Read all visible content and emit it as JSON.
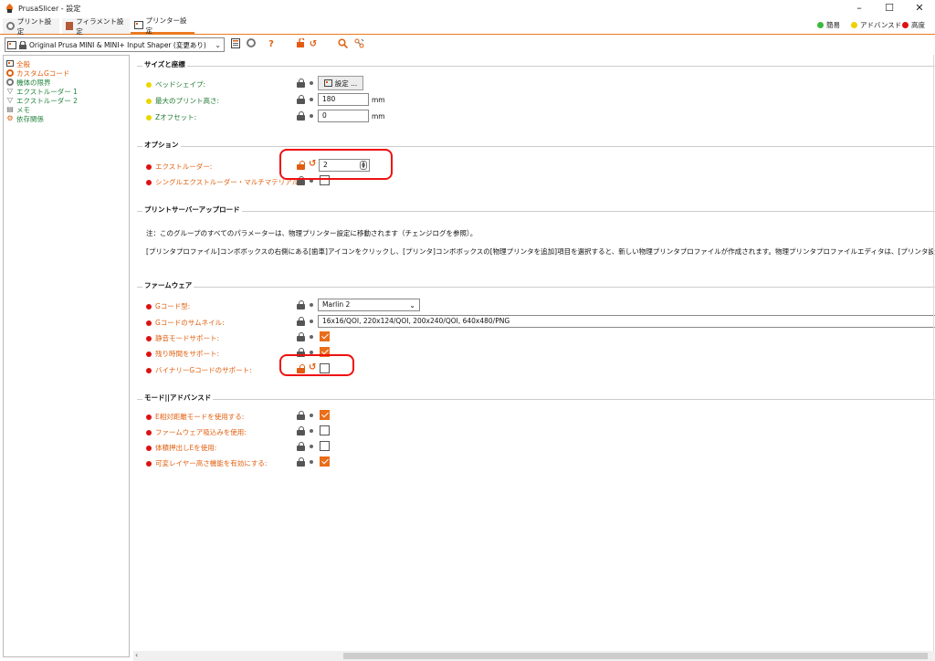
{
  "window": {
    "title": "PrusaSlicer - 設定",
    "minimize": "–",
    "maximize": "☐",
    "close": "✕"
  },
  "tabs": [
    {
      "label": "プリント設定",
      "icon": "gear-icon"
    },
    {
      "label": "フィラメント設定",
      "icon": "spool-icon"
    },
    {
      "label": "プリンター設定",
      "icon": "printer-icon",
      "active": true
    }
  ],
  "modes": [
    {
      "label": "簡易",
      "color": "#3cb93c"
    },
    {
      "label": "アドバンスド",
      "color": "#f0d000"
    },
    {
      "label": "高度",
      "color": "#dd1111"
    }
  ],
  "toolbar": {
    "preset": "Original Prusa MINI & MINI+ Input Shaper (変更あり)",
    "question": "?"
  },
  "sidebar": {
    "items": [
      {
        "label": "全般",
        "selected": true,
        "icon": "printer-icon"
      },
      {
        "label": "カスタムGコード",
        "icon": "gear-icon"
      },
      {
        "label": "機体の限界",
        "icon": "gear-icon"
      },
      {
        "label": "エクストルーダー 1",
        "icon": "funnel-icon"
      },
      {
        "label": "エクストルーダー 2",
        "icon": "funnel-icon"
      },
      {
        "label": "メモ",
        "icon": "notes-icon"
      },
      {
        "label": "依存関係",
        "icon": "dependency-icon"
      }
    ]
  },
  "groups": {
    "size": {
      "title": "サイズと座標",
      "bed_shape": {
        "label": "ベッドシェイプ:",
        "button": "設定 ..."
      },
      "max_height": {
        "label": "最大のプリント高さ:",
        "value": "180",
        "unit": "mm"
      },
      "z_offset": {
        "label": "Zオフセット:",
        "value": "0",
        "unit": "mm"
      }
    },
    "options": {
      "title": "オプション",
      "extruders": {
        "label": "エクストルーダー:",
        "value": "2"
      },
      "single_extruder_mm": {
        "label": "シングルエクストルーダー・マルチマテリアル:"
      }
    },
    "upload": {
      "title": "プリントサーバーアップロード",
      "note1": "注：このグループのすべてのパラメーターは、物理プリンター設定に移動されます（チェンジログを参照）。",
      "note2": "[プリンタプロファイル]コンボボックスの右側にある[歯車]アイコンをクリックし、[プリンタ]コンボボックスの[物理プリンタを追加]項目を選択すると、新しい物理プリンタプロファイルが作成されます。物理プリンタプロファイルエディタは、[プリンタ設定]タブの[歯車]アイコンをクリ"
    },
    "firmware": {
      "title": "ファームウェア",
      "gcode_flavor": {
        "label": "Gコード型:",
        "value": "Marlin 2"
      },
      "thumbnails": {
        "label": "Gコードのサムネイル:",
        "value": "16x16/QOI, 220x124/QOI, 200x240/QOI, 640x480/PNG"
      },
      "silent_mode": {
        "label": "静音モードサポート:",
        "checked": true
      },
      "remaining_time": {
        "label": "残り時間をサポート:",
        "checked": true
      },
      "binary_gcode": {
        "label": "バイナリーGコードのサポート:",
        "checked": false
      }
    },
    "advanced": {
      "title": "モード||アドバンスド",
      "relative_e": {
        "label": "E相対距離モードを使用する:",
        "checked": true
      },
      "fw_retraction": {
        "label": "ファームウェア吸込みを使用:",
        "checked": false
      },
      "volumetric_e": {
        "label": "体積押出しEを使用:",
        "checked": false
      },
      "variable_layer": {
        "label": "可変レイヤー高さ機能を有効にする:",
        "checked": true
      }
    }
  },
  "colors": {
    "accent": "#ea7a20",
    "highlight": "#e11111",
    "label_red": "#e06010",
    "label_green": "#1f7a30"
  }
}
